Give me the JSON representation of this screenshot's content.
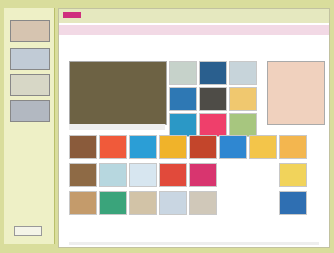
{
  "window": {
    "brand_label": "",
    "top_nav_labels": [
      "",
      "",
      ""
    ],
    "top_right_labels": [
      "",
      ""
    ]
  },
  "tabs": {
    "items": [
      "",
      "",
      "",
      "",
      "",
      "",
      "",
      "",
      ""
    ]
  },
  "colors": {
    "frame": "#d9dd9c",
    "accent": "#cf2f7d",
    "tab_bar": "#f2d9e5"
  }
}
